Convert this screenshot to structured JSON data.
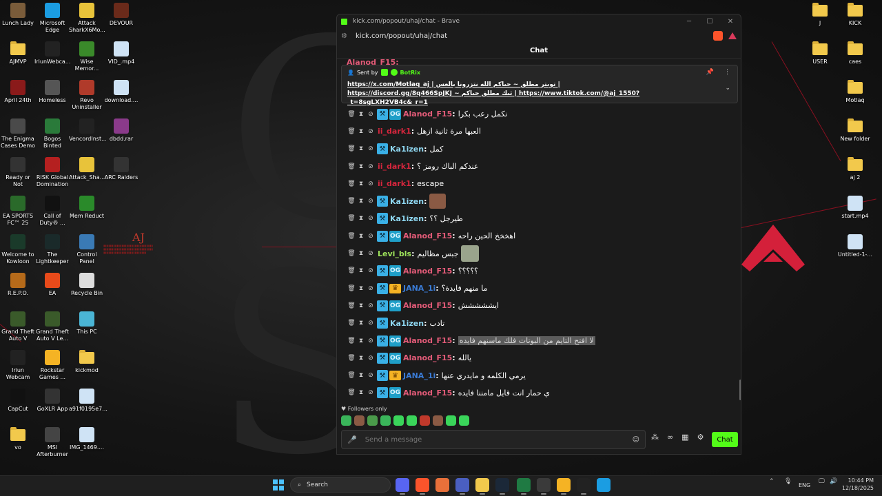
{
  "desktop": {
    "left_icons": [
      {
        "label": "Lunch Lady",
        "icon": "game-icon",
        "color": "#7a5c3a"
      },
      {
        "label": "Microsoft Edge",
        "icon": "edge-icon",
        "color": "#1b9de2"
      },
      {
        "label": "Attack SharkX6Mo...",
        "icon": "shark-icon",
        "color": "#e8c33a"
      },
      {
        "label": "DEVOUR",
        "icon": "devour-icon",
        "color": "#6a2a1a"
      },
      {
        "label": "AJMVP",
        "icon": "folder-icon",
        "color": "#f2c94c"
      },
      {
        "label": "IriunWebca...",
        "icon": "iriun-icon",
        "color": "#222"
      },
      {
        "label": "Wise Memor...",
        "icon": "wise-icon",
        "color": "#3a8a2a"
      },
      {
        "label": "VID_.mp4",
        "icon": "video-file-icon",
        "color": "#cfe3f5"
      },
      {
        "label": "April 24th",
        "icon": "image-icon",
        "color": "#8a1a1a"
      },
      {
        "label": "Homeless",
        "icon": "game-icon",
        "color": "#555"
      },
      {
        "label": "Revo Uninstaller",
        "icon": "revo-icon",
        "color": "#b03a2a"
      },
      {
        "label": "download....",
        "icon": "file-icon",
        "color": "#cfe3f5"
      },
      {
        "label": "The Enigma Cases Demo",
        "icon": "game-icon",
        "color": "#4a4a4a"
      },
      {
        "label": "Bogos Binted",
        "icon": "game-icon",
        "color": "#2a7a3a"
      },
      {
        "label": "VencordInst...",
        "icon": "vencord-icon",
        "color": "#222"
      },
      {
        "label": "dbdd.rar",
        "icon": "rar-icon",
        "color": "#8a3a8a"
      },
      {
        "label": "Ready or Not",
        "icon": "game-icon",
        "color": "#333"
      },
      {
        "label": "RISK Global Domination",
        "icon": "risk-icon",
        "color": "#b52020"
      },
      {
        "label": "Attack_Sha...",
        "icon": "shark-icon",
        "color": "#e8c33a"
      },
      {
        "label": "ARC Raiders",
        "icon": "arc-icon",
        "color": "#333"
      },
      {
        "label": "EA SPORTS FC™ 25",
        "icon": "game-icon",
        "color": "#2a6a2a"
      },
      {
        "label": "Call of Duty® ...",
        "icon": "cod-icon",
        "color": "#111"
      },
      {
        "label": "Mem Reduct",
        "icon": "memreduct-icon",
        "color": "#2a8a2a"
      },
      {
        "label": "Welcome to Kowloon",
        "icon": "game-icon",
        "color": "#1a3a2a"
      },
      {
        "label": "The Lightkeeper",
        "icon": "game-icon",
        "color": "#1a2a2a"
      },
      {
        "label": "Control Panel",
        "icon": "control-panel-icon",
        "color": "#3a7ab5"
      },
      {
        "label": "R.E.P.O.",
        "icon": "game-icon",
        "color": "#b56a1a"
      },
      {
        "label": "EA",
        "icon": "ea-icon",
        "color": "#e84a1a"
      },
      {
        "label": "Recycle Bin",
        "icon": "recycle-bin-icon",
        "color": "#ddd"
      },
      {
        "label": "Grand Theft Auto V",
        "icon": "gta-icon",
        "color": "#3a5a2a"
      },
      {
        "label": "Grand Theft Auto V Le...",
        "icon": "gta-icon",
        "color": "#3a5a2a"
      },
      {
        "label": "This PC",
        "icon": "pc-icon",
        "color": "#4ab5d5"
      },
      {
        "label": "Iriun Webcam",
        "icon": "iriun-icon",
        "color": "#222"
      },
      {
        "label": "Rockstar Games ...",
        "icon": "rockstar-icon",
        "color": "#f5b324"
      },
      {
        "label": "kickmod",
        "icon": "folder-icon",
        "color": "#f2c94c"
      },
      {
        "label": "CapCut",
        "icon": "capcut-icon",
        "color": "#111"
      },
      {
        "label": "GoXLR App",
        "icon": "goxlr-icon",
        "color": "#333"
      },
      {
        "label": "a91f0195e7...",
        "icon": "image-file-icon",
        "color": "#cfe3f5"
      },
      {
        "label": "vo",
        "icon": "folder-icon",
        "color": "#f2c94c"
      },
      {
        "label": "MSI Afterburner",
        "icon": "msi-icon",
        "color": "#444"
      },
      {
        "label": "IMG_1469....",
        "icon": "image-file-icon",
        "color": "#cfe3f5"
      }
    ],
    "right_icons": [
      {
        "label": "J",
        "icon": "folder-icon"
      },
      {
        "label": "KICK",
        "icon": "folder-icon"
      },
      {
        "label": "USER",
        "icon": "folder-icon"
      },
      {
        "label": "caes",
        "icon": "folder-icon"
      },
      {
        "label": "Motlaq",
        "icon": "folder-icon"
      },
      {
        "label": "New folder",
        "icon": "folder-icon"
      },
      {
        "label": "aj 2",
        "icon": "folder-icon"
      },
      {
        "label": "start.mp4",
        "icon": "video-file-icon"
      },
      {
        "label": "Untitled-1-...",
        "icon": "image-file-icon"
      }
    ],
    "watermark": "AJ"
  },
  "browser": {
    "window_title": "kick.com/popout/uhaj/chat - Brave",
    "url": "kick.com/popout/uhaj/chat",
    "chat_title": "Chat",
    "top_partial_user": "Alanod_F15:"
  },
  "pinned": {
    "sent_by_label": "Sent by",
    "bot_name": "BotRix",
    "text": "https://x.com/Motlaq_aj | تويتر مطلق ~ حياكم الله نتزرونا بالعس | https://discord.gg/8q466SpJKJ ~ ثيك مطلق حياكم | https://www.tiktok.com/@aj_1550?_t=8sgLXH2VB4c&_r=1"
  },
  "messages": [
    {
      "user": "Alanod_F15",
      "color": "#e35b78",
      "og": true,
      "crown": false,
      "text": "نكمل رعب بكرا"
    },
    {
      "user": "ii_dark1",
      "color": "#d6263d",
      "og": false,
      "crown": false,
      "sub": false,
      "text": "العبها مرة ثانية ازهل"
    },
    {
      "user": "Ka1izen",
      "color": "#8fd8f2",
      "og": false,
      "crown": false,
      "text": "كمل"
    },
    {
      "user": "ii_dark1",
      "color": "#d6263d",
      "og": false,
      "crown": false,
      "sub": false,
      "text": "عندكم الباك رومز ؟"
    },
    {
      "user": "ii_dark1",
      "color": "#d6263d",
      "og": false,
      "crown": false,
      "sub": false,
      "text": "escape"
    },
    {
      "user": "Ka1izen",
      "color": "#8fd8f2",
      "og": false,
      "crown": false,
      "text": "",
      "emote": true
    },
    {
      "user": "Ka1izen",
      "color": "#8fd8f2",
      "og": false,
      "crown": false,
      "text": "طيرجل ؟؟"
    },
    {
      "user": "Alanod_F15",
      "color": "#e35b78",
      "og": true,
      "crown": false,
      "text": "اهخخخ الحين راحه"
    },
    {
      "user": "Levi_bls",
      "color": "#9ee35b",
      "og": false,
      "crown": false,
      "sub": false,
      "text": "جبس مظاليم",
      "emote2": true
    },
    {
      "user": "Alanod_F15",
      "color": "#e35b78",
      "og": true,
      "crown": false,
      "text": "؟؟؟؟؟"
    },
    {
      "user": "JANA_1i",
      "color": "#3a7bd5",
      "og": false,
      "crown": true,
      "text": "ما منهم فايدة؟"
    },
    {
      "user": "Alanod_F15",
      "color": "#e35b78",
      "og": true,
      "crown": false,
      "text": "ايششششش"
    },
    {
      "user": "Ka1izen",
      "color": "#8fd8f2",
      "og": false,
      "crown": false,
      "text": "تادب"
    },
    {
      "user": "Alanod_F15",
      "color": "#e35b78",
      "og": true,
      "crown": false,
      "text": "لا افتح التايم من البوتات فلك ماسنهم فايده",
      "highlight": true
    },
    {
      "user": "Alanod_F15",
      "color": "#e35b78",
      "og": true,
      "crown": false,
      "text": "يالله"
    },
    {
      "user": "JANA_1i",
      "color": "#3a7bd5",
      "og": false,
      "crown": true,
      "text": "يرمي الكلمه و مايدري عنها"
    },
    {
      "user": "Alanod_F15",
      "color": "#e35b78",
      "og": true,
      "crown": false,
      "text": "ي حمار انت قايل مامننا فايده"
    }
  ],
  "footer": {
    "followers_only": "Followers only",
    "input_placeholder": "Send a message",
    "chat_button": "Chat",
    "emote_colors": [
      "#3ab55a",
      "#8a5a44",
      "#4a9a4a",
      "#3ab55a",
      "#3ad55a",
      "#3ad55a",
      "#c0392b",
      "#8a5a44",
      "#3ad55a",
      "#3ad55a"
    ]
  },
  "taskbar": {
    "search_placeholder": "Search",
    "language": "ENG",
    "time": "10:44 PM",
    "date": "12/18/2025",
    "apps": [
      {
        "name": "discord-icon",
        "color": "#5865f2"
      },
      {
        "name": "brave-icon",
        "color": "#fb542b"
      },
      {
        "name": "autocad-icon",
        "color": "#e8703a"
      },
      {
        "name": "teams-icon",
        "color": "#4a5fc1"
      },
      {
        "name": "file-explorer-icon",
        "color": "#f2c94c"
      },
      {
        "name": "steam-icon",
        "color": "#1b2838"
      },
      {
        "name": "excel-icon",
        "color": "#1f7a43"
      },
      {
        "name": "game-controller-icon",
        "color": "#3a3a3a"
      },
      {
        "name": "chat-app-icon",
        "color": "#f5b324"
      },
      {
        "name": "iriun-icon",
        "color": "#222"
      },
      {
        "name": "shark-icon",
        "color": "#1b9de2"
      }
    ]
  }
}
